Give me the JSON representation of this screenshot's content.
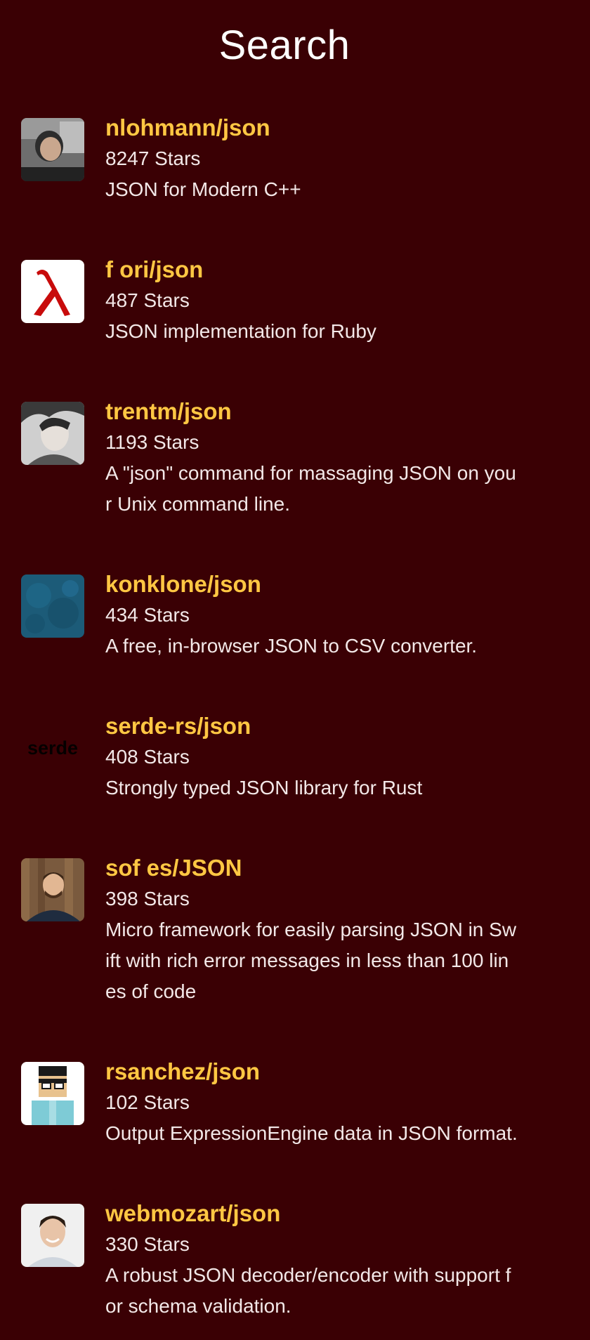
{
  "header": {
    "title": "Search"
  },
  "colors": {
    "background": "#3a0004",
    "repo_name": "#ffc743",
    "text": "#f3e8e8"
  },
  "repos": [
    {
      "name": "nlohmann/json",
      "stars": "8247 Stars",
      "description": "JSON for Modern C++",
      "avatar_icon": "user-photo-icon"
    },
    {
      "name": "f ori/json",
      "stars": "487 Stars",
      "description": "JSON implementation for Ruby",
      "avatar_icon": "lambda-logo-icon"
    },
    {
      "name": "trentm/json",
      "stars": "1193 Stars",
      "description": "A \"json\" command for massaging JSON on you\nr Unix command line.",
      "avatar_icon": "user-sketch-icon"
    },
    {
      "name": "konklone/json",
      "stars": "434 Stars",
      "description": "A free, in-browser JSON to CSV converter.",
      "avatar_icon": "blue-texture-icon"
    },
    {
      "name": "serde-rs/json",
      "stars": "408 Stars",
      "description": "Strongly typed JSON library for Rust",
      "avatar_icon": "serde-logo-icon",
      "avatar_text": "serde"
    },
    {
      "name": "sof es/JSON",
      "stars": "398 Stars",
      "description": "Micro framework for easily parsing JSON in Sw\nift with rich error messages in less than 100 lin\nes of code",
      "avatar_icon": "user-photo-icon"
    },
    {
      "name": "rsanchez/json",
      "stars": "102 Stars",
      "description": "Output ExpressionEngine data in JSON format.",
      "avatar_icon": "pixel-character-icon"
    },
    {
      "name": "webmozart/json",
      "stars": "330 Stars",
      "description": "A robust JSON decoder/encoder with support f\nor schema validation.",
      "avatar_icon": "user-photo-icon"
    }
  ]
}
